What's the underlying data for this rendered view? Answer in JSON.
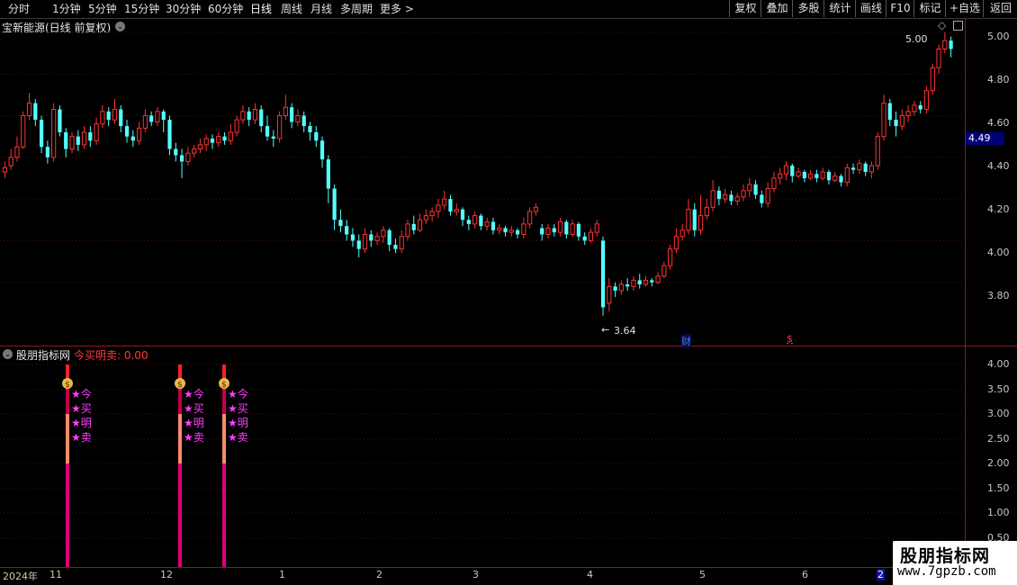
{
  "toolbar": {
    "periods": [
      "分时",
      "1分钟",
      "5分钟",
      "15分钟",
      "30分钟",
      "60分钟",
      "日线",
      "周线",
      "月线",
      "多周期",
      "更多 >"
    ],
    "active_period": "日线",
    "right_buttons": [
      "复权",
      "叠加",
      "多股",
      "统计",
      "画线",
      "F10",
      "标记",
      "+自选",
      "返回"
    ]
  },
  "main_chart": {
    "title": "宝新能源(日线 前复权)",
    "price_axis_labels": [
      "5.00",
      "4.80",
      "4.60",
      "4.40",
      "4.20",
      "4.00",
      "3.80"
    ],
    "current_price": "4.49",
    "high_marker": "5.00",
    "low_marker": "3.64",
    "finance_marker": "财",
    "dividend_marker": "$"
  },
  "indicator_panel": {
    "name": "股朋指标网",
    "formula_label": "今买明卖: 0.00",
    "axis_labels": [
      "4.00",
      "3.50",
      "3.00",
      "2.50",
      "2.00",
      "1.50",
      "1.00",
      "0.50"
    ],
    "signal_words": [
      "★今",
      "★买",
      "★明",
      "★卖"
    ]
  },
  "date_axis": {
    "year_label": "2024年",
    "months": [
      "11",
      "12",
      "1",
      "2",
      "3",
      "4",
      "5",
      "6",
      "2"
    ]
  },
  "watermark": {
    "title": "股朋指标网",
    "url": "www.7gpzb.com"
  },
  "chart_data": {
    "type": "candlestick",
    "title": "宝新能源(日线 前复权)",
    "ylim": [
      3.6,
      5.06
    ],
    "y_ticks": [
      3.8,
      4.0,
      4.2,
      4.4,
      4.6,
      4.8,
      5.0
    ],
    "colors": {
      "up": "#ff3232",
      "down": "#54ffff"
    },
    "candles": [
      [
        4.33,
        4.35,
        4.38,
        4.3
      ],
      [
        4.36,
        4.4,
        4.44,
        4.34
      ],
      [
        4.4,
        4.45,
        4.5,
        4.38
      ],
      [
        4.45,
        4.6,
        4.62,
        4.44
      ],
      [
        4.6,
        4.66,
        4.71,
        4.58
      ],
      [
        4.66,
        4.58,
        4.68,
        4.55
      ],
      [
        4.58,
        4.45,
        4.6,
        4.42
      ],
      [
        4.45,
        4.4,
        4.48,
        4.37
      ],
      [
        4.4,
        4.63,
        4.66,
        4.38
      ],
      [
        4.63,
        4.52,
        4.65,
        4.5
      ],
      [
        4.52,
        4.44,
        4.54,
        4.4
      ],
      [
        4.44,
        4.5,
        4.52,
        4.42
      ],
      [
        4.5,
        4.46,
        4.53,
        4.43
      ],
      [
        4.46,
        4.52,
        4.55,
        4.44
      ],
      [
        4.52,
        4.48,
        4.55,
        4.45
      ],
      [
        4.48,
        4.56,
        4.59,
        4.46
      ],
      [
        4.56,
        4.62,
        4.65,
        4.54
      ],
      [
        4.62,
        4.58,
        4.64,
        4.55
      ],
      [
        4.58,
        4.63,
        4.68,
        4.56
      ],
      [
        4.63,
        4.55,
        4.65,
        4.52
      ],
      [
        4.55,
        4.5,
        4.58,
        4.47
      ],
      [
        4.5,
        4.48,
        4.53,
        4.45
      ],
      [
        4.48,
        4.54,
        4.57,
        4.46
      ],
      [
        4.54,
        4.6,
        4.63,
        4.52
      ],
      [
        4.6,
        4.57,
        4.62,
        4.55
      ],
      [
        4.57,
        4.62,
        4.64,
        4.55
      ],
      [
        4.62,
        4.58,
        4.63,
        4.52
      ],
      [
        4.58,
        4.44,
        4.6,
        4.41
      ],
      [
        4.44,
        4.41,
        4.47,
        4.38
      ],
      [
        4.41,
        4.38,
        4.44,
        4.3
      ],
      [
        4.38,
        4.42,
        4.45,
        4.36
      ],
      [
        4.42,
        4.44,
        4.46,
        4.4
      ],
      [
        4.44,
        4.46,
        4.49,
        4.42
      ],
      [
        4.46,
        4.49,
        4.51,
        4.43
      ],
      [
        4.49,
        4.47,
        4.51,
        4.44
      ],
      [
        4.47,
        4.5,
        4.52,
        4.45
      ],
      [
        4.5,
        4.48,
        4.52,
        4.46
      ],
      [
        4.48,
        4.52,
        4.56,
        4.46
      ],
      [
        4.52,
        4.58,
        4.6,
        4.5
      ],
      [
        4.58,
        4.62,
        4.65,
        4.56
      ],
      [
        4.62,
        4.58,
        4.64,
        4.55
      ],
      [
        4.58,
        4.63,
        4.66,
        4.56
      ],
      [
        4.63,
        4.55,
        4.65,
        4.52
      ],
      [
        4.55,
        4.5,
        4.6,
        4.48
      ],
      [
        4.5,
        4.49,
        4.53,
        4.45
      ],
      [
        4.49,
        4.6,
        4.62,
        4.47
      ],
      [
        4.6,
        4.64,
        4.7,
        4.58
      ],
      [
        4.64,
        4.57,
        4.66,
        4.54
      ],
      [
        4.57,
        4.6,
        4.63,
        4.55
      ],
      [
        4.6,
        4.55,
        4.62,
        4.52
      ],
      [
        4.55,
        4.52,
        4.57,
        4.48
      ],
      [
        4.52,
        4.48,
        4.55,
        4.45
      ],
      [
        4.48,
        4.39,
        4.5,
        4.35
      ],
      [
        4.39,
        4.25,
        4.41,
        4.18
      ],
      [
        4.25,
        4.1,
        4.27,
        4.05
      ],
      [
        4.1,
        4.07,
        4.15,
        4.04
      ],
      [
        4.07,
        4.03,
        4.1,
        4.0
      ],
      [
        4.03,
        4.0,
        4.06,
        3.97
      ],
      [
        4.0,
        3.96,
        4.03,
        3.92
      ],
      [
        3.96,
        4.03,
        4.06,
        3.94
      ],
      [
        4.03,
        4.0,
        4.05,
        3.97
      ],
      [
        4.0,
        4.02,
        4.04,
        3.98
      ],
      [
        4.02,
        4.05,
        4.07,
        3.99
      ],
      [
        4.05,
        3.98,
        4.06,
        3.95
      ],
      [
        3.98,
        3.96,
        4.01,
        3.94
      ],
      [
        3.96,
        4.02,
        4.05,
        3.94
      ],
      [
        4.02,
        4.08,
        4.1,
        4.0
      ],
      [
        4.08,
        4.05,
        4.12,
        4.03
      ],
      [
        4.05,
        4.1,
        4.13,
        4.04
      ],
      [
        4.1,
        4.12,
        4.15,
        4.08
      ],
      [
        4.12,
        4.14,
        4.16,
        4.09
      ],
      [
        4.14,
        4.17,
        4.2,
        4.11
      ],
      [
        4.17,
        4.2,
        4.24,
        4.15
      ],
      [
        4.2,
        4.14,
        4.22,
        4.12
      ],
      [
        4.14,
        4.15,
        4.18,
        4.12
      ],
      [
        4.15,
        4.1,
        4.16,
        4.07
      ],
      [
        4.1,
        4.08,
        4.12,
        4.05
      ],
      [
        4.08,
        4.12,
        4.14,
        4.06
      ],
      [
        4.12,
        4.07,
        4.13,
        4.05
      ],
      [
        4.07,
        4.09,
        4.11,
        4.05
      ],
      [
        4.09,
        4.05,
        4.11,
        4.03
      ],
      [
        4.05,
        4.06,
        4.08,
        4.03
      ],
      [
        4.06,
        4.04,
        4.07,
        4.02
      ],
      [
        4.04,
        4.05,
        4.07,
        4.02
      ],
      [
        4.05,
        4.03,
        4.06,
        4.01
      ],
      [
        4.03,
        4.08,
        4.11,
        4.01
      ],
      [
        4.08,
        4.14,
        4.16,
        4.06
      ],
      [
        4.14,
        4.16,
        4.18,
        4.12
      ],
      [
        4.06,
        4.03,
        4.08,
        4.0
      ],
      [
        4.03,
        4.06,
        4.08,
        4.01
      ],
      [
        4.06,
        4.04,
        4.08,
        4.02
      ],
      [
        4.04,
        4.09,
        4.11,
        4.02
      ],
      [
        4.09,
        4.03,
        4.1,
        4.01
      ],
      [
        4.03,
        4.08,
        4.1,
        4.02
      ],
      [
        4.08,
        4.02,
        4.09,
        4.0
      ],
      [
        4.02,
        4.0,
        4.04,
        3.98
      ],
      [
        4.0,
        4.04,
        4.06,
        3.99
      ],
      [
        4.04,
        4.08,
        4.1,
        4.02
      ],
      [
        4.0,
        3.68,
        4.02,
        3.64
      ],
      [
        3.7,
        3.78,
        3.82,
        3.66
      ],
      [
        3.78,
        3.76,
        3.8,
        3.73
      ],
      [
        3.76,
        3.79,
        3.81,
        3.74
      ],
      [
        3.79,
        3.78,
        3.82,
        3.76
      ],
      [
        3.78,
        3.81,
        3.83,
        3.76
      ],
      [
        3.81,
        3.79,
        3.84,
        3.77
      ],
      [
        3.79,
        3.81,
        3.83,
        3.78
      ],
      [
        3.81,
        3.8,
        3.82,
        3.78
      ],
      [
        3.8,
        3.83,
        3.85,
        3.79
      ],
      [
        3.83,
        3.88,
        3.9,
        3.82
      ],
      [
        3.88,
        3.96,
        3.98,
        3.86
      ],
      [
        3.96,
        4.02,
        4.06,
        3.94
      ],
      [
        4.02,
        4.05,
        4.08,
        4.0
      ],
      [
        4.05,
        4.15,
        4.2,
        4.03
      ],
      [
        4.15,
        4.05,
        4.18,
        4.02
      ],
      [
        4.05,
        4.12,
        4.22,
        4.03
      ],
      [
        4.12,
        4.16,
        4.2,
        4.1
      ],
      [
        4.16,
        4.24,
        4.29,
        4.14
      ],
      [
        4.24,
        4.2,
        4.26,
        4.17
      ],
      [
        4.2,
        4.22,
        4.25,
        4.18
      ],
      [
        4.22,
        4.19,
        4.24,
        4.17
      ],
      [
        4.19,
        4.21,
        4.23,
        4.17
      ],
      [
        4.21,
        4.24,
        4.27,
        4.19
      ],
      [
        4.24,
        4.27,
        4.3,
        4.21
      ],
      [
        4.27,
        4.22,
        4.29,
        4.2
      ],
      [
        4.22,
        4.18,
        4.24,
        4.16
      ],
      [
        4.18,
        4.25,
        4.28,
        4.16
      ],
      [
        4.25,
        4.3,
        4.33,
        4.23
      ],
      [
        4.3,
        4.32,
        4.35,
        4.27
      ],
      [
        4.32,
        4.36,
        4.38,
        4.29
      ],
      [
        4.36,
        4.31,
        4.37,
        4.28
      ],
      [
        4.31,
        4.33,
        4.35,
        4.3
      ],
      [
        4.33,
        4.3,
        4.34,
        4.28
      ],
      [
        4.3,
        4.32,
        4.34,
        4.29
      ],
      [
        4.32,
        4.3,
        4.34,
        4.28
      ],
      [
        4.3,
        4.33,
        4.35,
        4.29
      ],
      [
        4.33,
        4.29,
        4.34,
        4.27
      ],
      [
        4.29,
        4.31,
        4.33,
        4.28
      ],
      [
        4.31,
        4.28,
        4.32,
        4.26
      ],
      [
        4.28,
        4.35,
        4.37,
        4.26
      ],
      [
        4.35,
        4.34,
        4.37,
        4.32
      ],
      [
        4.34,
        4.37,
        4.39,
        4.32
      ],
      [
        4.37,
        4.33,
        4.38,
        4.31
      ],
      [
        4.33,
        4.36,
        4.38,
        4.3
      ],
      [
        4.36,
        4.5,
        4.52,
        4.34
      ],
      [
        4.5,
        4.66,
        4.7,
        4.48
      ],
      [
        4.66,
        4.58,
        4.68,
        4.55
      ],
      [
        4.58,
        4.55,
        4.62,
        4.5
      ],
      [
        4.55,
        4.6,
        4.63,
        4.53
      ],
      [
        4.6,
        4.62,
        4.65,
        4.57
      ],
      [
        4.62,
        4.65,
        4.67,
        4.6
      ],
      [
        4.65,
        4.63,
        4.67,
        4.61
      ],
      [
        4.63,
        4.72,
        4.74,
        4.61
      ],
      [
        4.72,
        4.83,
        4.85,
        4.7
      ],
      [
        4.83,
        4.92,
        4.94,
        4.8
      ],
      [
        4.92,
        4.96,
        5.0,
        4.9
      ],
      [
        4.96,
        4.92,
        4.98,
        4.88
      ]
    ]
  }
}
